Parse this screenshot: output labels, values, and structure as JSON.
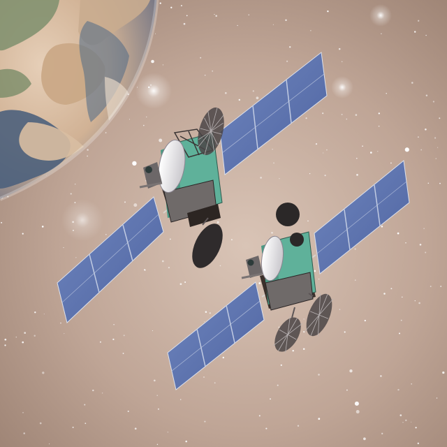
{
  "image": {
    "description_tag": "satellites-over-earth",
    "colors": {
      "space_base": "#b79c8c",
      "space_warm": "#d7c0b1",
      "space_dark": "#8f7467",
      "panel_blue": "#5d74ad",
      "panel_line": "#b8c4dd",
      "body_green": "#5faf96",
      "body_dark": "#3a2f2a",
      "dish_light": "#e7e6ea",
      "dish_dark": "#2f2c2d",
      "earth_ocean": "#4b5f7c",
      "earth_land": "#d7b99a",
      "earth_green": "#6f8a5a"
    }
  }
}
